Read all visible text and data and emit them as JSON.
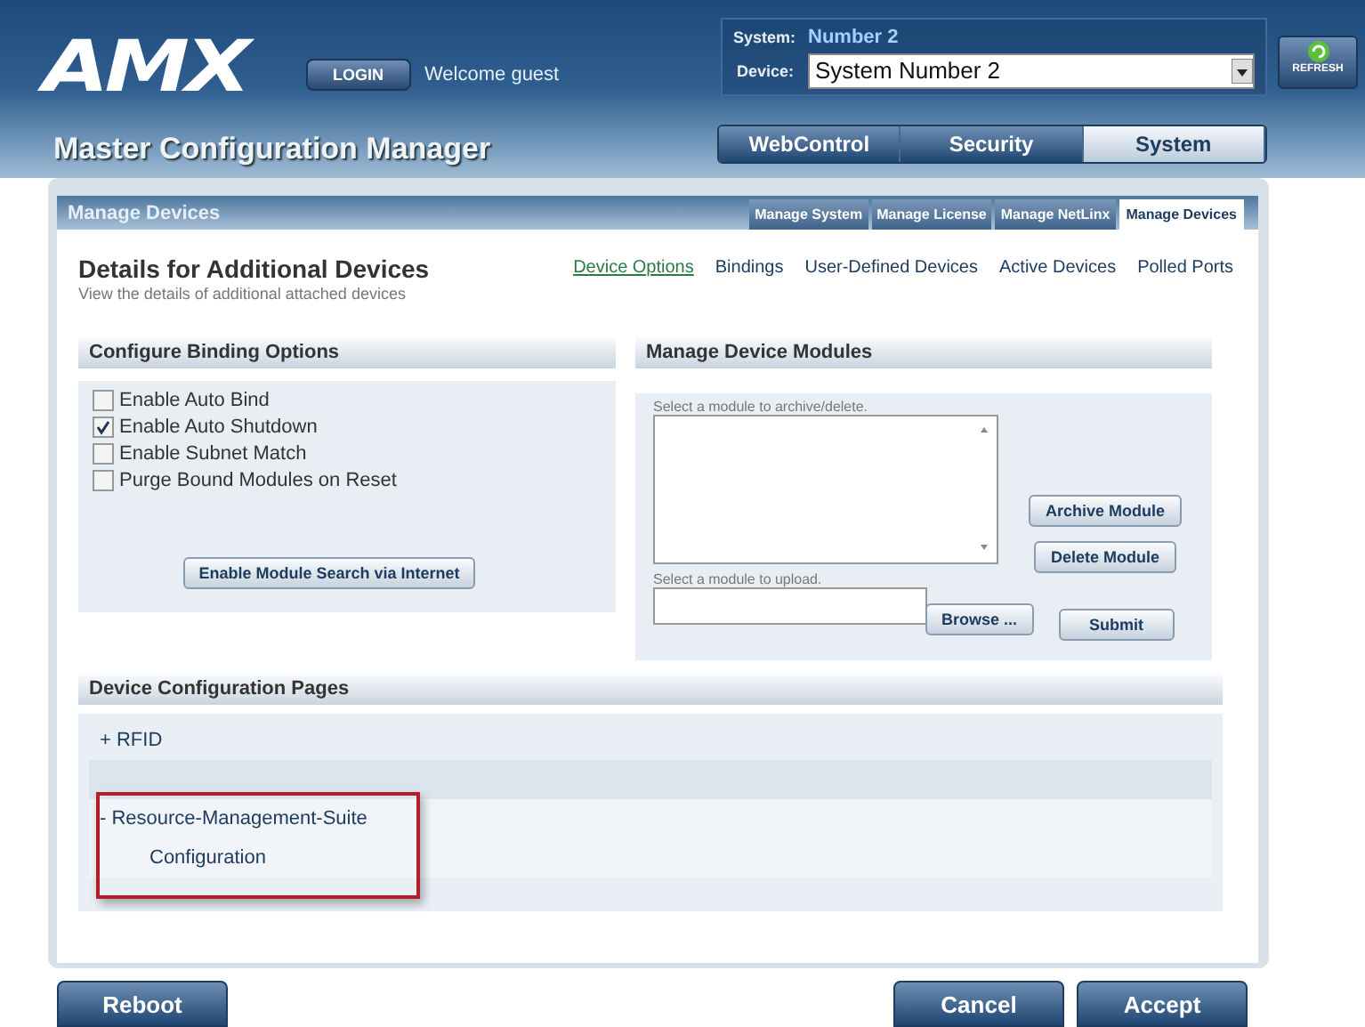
{
  "header": {
    "logo": "AMX",
    "login": "LOGIN",
    "welcome": "Welcome guest",
    "system_label": "System:",
    "system_value": "Number 2",
    "device_label": "Device:",
    "device_value": "System Number 2",
    "refresh": "REFRESH"
  },
  "title": "Master Configuration Manager",
  "nav_tabs": [
    {
      "label": "WebControl",
      "selected": false
    },
    {
      "label": "Security",
      "selected": false
    },
    {
      "label": "System",
      "selected": true
    }
  ],
  "panel": {
    "title": "Manage Devices",
    "tabs": [
      {
        "label": "Manage System",
        "selected": false
      },
      {
        "label": "Manage License",
        "selected": false
      },
      {
        "label": "Manage NetLinx",
        "selected": false
      },
      {
        "label": "Manage Devices",
        "selected": true
      }
    ],
    "heading": "Details for Additional Devices",
    "subheading": "View the details of additional attached devices",
    "links": [
      {
        "label": "Device Options",
        "selected": true
      },
      {
        "label": "Bindings",
        "selected": false
      },
      {
        "label": "User-Defined Devices",
        "selected": false
      },
      {
        "label": "Active Devices",
        "selected": false
      },
      {
        "label": "Polled Ports",
        "selected": false
      }
    ],
    "binding": {
      "title": "Configure Binding Options",
      "options": [
        {
          "label": "Enable Auto Bind",
          "checked": false
        },
        {
          "label": "Enable Auto Shutdown",
          "checked": true
        },
        {
          "label": "Enable Subnet Match",
          "checked": false
        },
        {
          "label": "Purge Bound Modules on Reset",
          "checked": false
        }
      ],
      "button": "Enable Module Search via Internet"
    },
    "modules": {
      "title": "Manage Device Modules",
      "list_label": "Select a module to archive/delete.",
      "archive": "Archive Module",
      "delete": "Delete Module",
      "upload_label": "Select a module to upload.",
      "browse": "Browse ...",
      "submit": "Submit"
    },
    "config_pages": {
      "title": "Device Configuration Pages",
      "items": [
        {
          "toggle": "+",
          "label": "RFID",
          "expanded": false,
          "highlight": false
        },
        {
          "toggle": "-",
          "label": "Resource-Management-Suite",
          "expanded": true,
          "highlight": true,
          "children": [
            {
              "label": "Configuration"
            }
          ]
        }
      ]
    }
  },
  "footer": {
    "left": [
      "Reboot"
    ],
    "right": [
      "Cancel",
      "Accept"
    ]
  }
}
